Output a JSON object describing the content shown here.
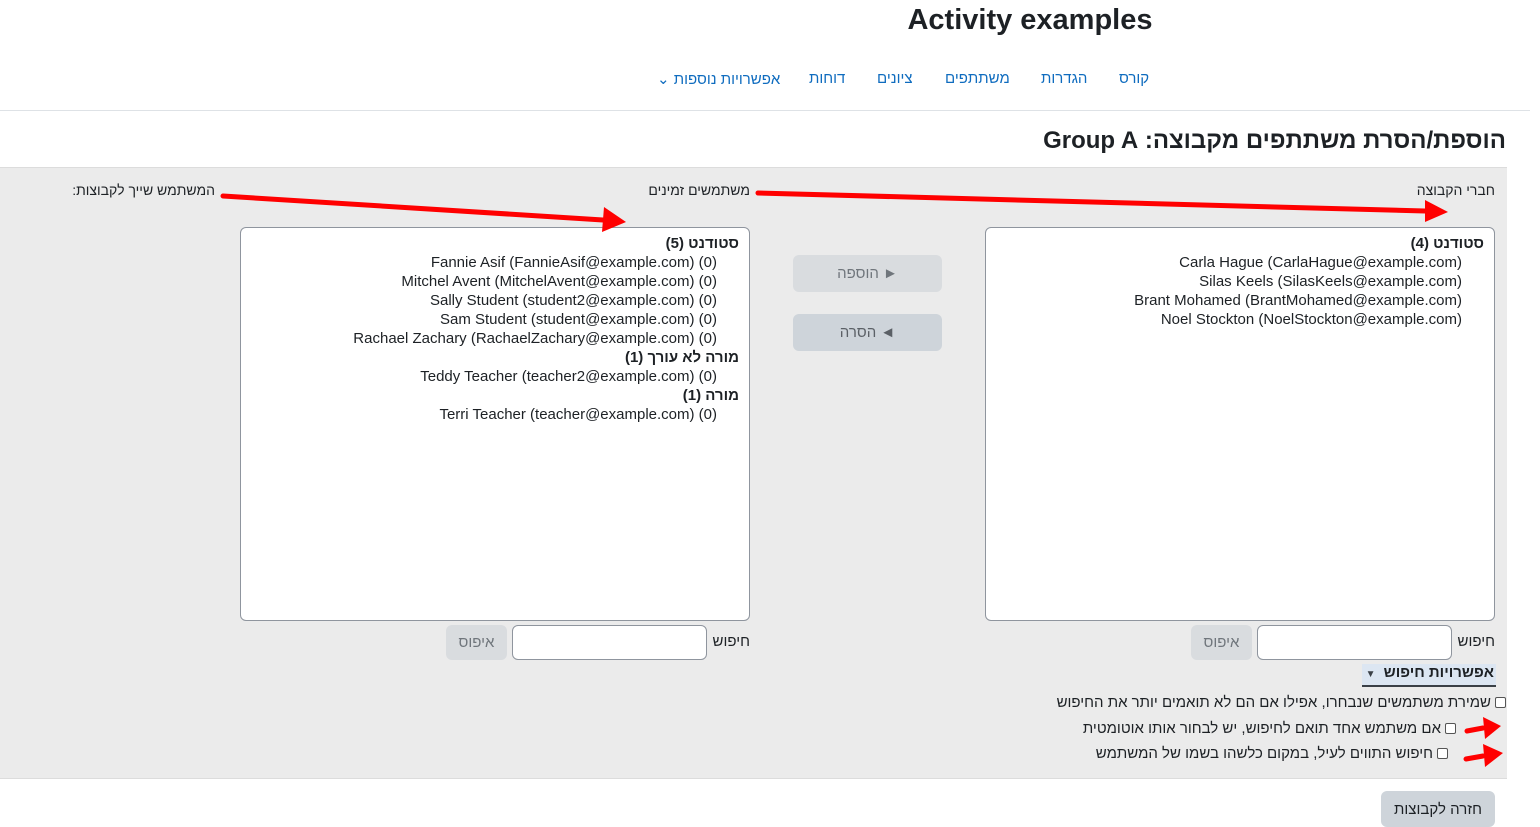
{
  "course": {
    "title": "Activity examples"
  },
  "nav": {
    "course": "קורס",
    "settings": "הגדרות",
    "participants": "משתתפים",
    "grades": "ציונים",
    "reports": "דוחות",
    "more": "אפשרויות נוספות ⌄"
  },
  "page": {
    "heading": "הוספת/הסרת משתתפים מקבוצה: Group A"
  },
  "members": {
    "label": "חברי הקבוצה",
    "groups": [
      {
        "title": "סטודנט (4)",
        "users": [
          "Carla Hague (CarlaHague@example.com)",
          "Silas Keels (SilasKeels@example.com)",
          "Brant Mohamed (BrantMohamed@example.com)",
          "Noel Stockton (NoelStockton@example.com)"
        ]
      }
    ],
    "search_label": "חיפוש",
    "clear_label": "איפוס"
  },
  "potential": {
    "label": "משתמשים זמינים",
    "groups": [
      {
        "title": "סטודנט (5)",
        "users": [
          "Fannie Asif  (FannieAsif@example.com) (0)",
          "Mitchel Avent (MitchelAvent@example.com) (0)",
          "Sally Student (student2@example.com) (0)",
          "Sam Student (student@example.com) (0)",
          "Rachael Zachary (RachaelZachary@example.com) (0)"
        ]
      },
      {
        "title": "מורה לא עורך (1)",
        "users": [
          "Teddy Teacher (teacher2@example.com) (0)"
        ]
      },
      {
        "title": "מורה (1)",
        "users": [
          "Terri Teacher (teacher@example.com) (0)"
        ]
      }
    ],
    "search_label": "חיפוש",
    "clear_label": "איפוס"
  },
  "user_groups_label": "המשתמש שייך לקבוצות:",
  "buttons": {
    "add": "► הוספה",
    "remove": "◄ הסרה",
    "back": "חזרה לקבוצות"
  },
  "search_options": {
    "header": "אפשרויות חיפוש",
    "options": [
      "שמירת משתמשים שנבחרו, אפילו אם הם לא תואמים יותר את החיפוש",
      "אם משתמש אחד תואם לחיפוש, יש לבחור אותו אוטומטית",
      "חיפוש התווים לעיל, במקום כלשהו בשמו של המשתמש"
    ]
  },
  "colors": {
    "link": "#0f6cbf",
    "annotation_arrow": "#ff0000",
    "panel": "#ebebeb"
  }
}
